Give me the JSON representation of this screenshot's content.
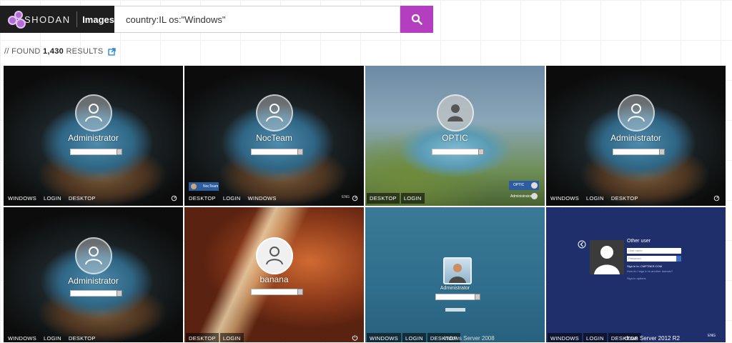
{
  "brand": {
    "name": "SHODAN",
    "section": "Images"
  },
  "search": {
    "query": "country:IL os:\"Windows\""
  },
  "results": {
    "prefix": "// FOUND",
    "count": "1,430",
    "suffix": "RESULTS"
  },
  "tiles": [
    {
      "user": "Administrator",
      "tags": [
        "WINDOWS",
        "LOGIN",
        "DESKTOP"
      ]
    },
    {
      "user": "NocTeam",
      "tags": [
        "DESKTOP",
        "LOGIN",
        "WINDOWS"
      ],
      "side_user": "NocTeam",
      "lang": "ENG"
    },
    {
      "user": "OPTIC",
      "tags": [
        "DESKTOP",
        "LOGIN"
      ],
      "side_users": [
        "OPTIC",
        "Administrator"
      ]
    },
    {
      "user": "Administrator",
      "tags": [
        "WINDOWS",
        "LOGIN",
        "DESKTOP"
      ]
    },
    {
      "user": "Administrator",
      "tags": [
        "WINDOWS",
        "LOGIN",
        "DESKTOP"
      ]
    },
    {
      "user": "banana",
      "tags": [
        "DESKTOP",
        "LOGIN"
      ]
    },
    {
      "user": "Administrator",
      "tags": [
        "WINDOWS",
        "LOGIN",
        "DESKTOP"
      ],
      "os": "indows Server 2008"
    },
    {
      "user": "Other user",
      "tags": [
        "WINDOWS",
        "LOGIN",
        "DESKTOP"
      ],
      "os": "dows Server 2012 R2",
      "lang": "ENG",
      "fields": [
        "User name",
        "Password"
      ],
      "links": [
        "Sign in to: CMPTBKR.COM",
        "How do I sign in to another domain?",
        "Sign-in options"
      ]
    }
  ],
  "colors": {
    "accent": "#b43ec0",
    "brand_bg": "#1e1e1e",
    "link": "#2a8ad4"
  }
}
